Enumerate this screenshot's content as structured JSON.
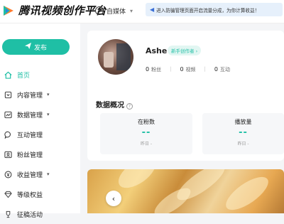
{
  "topbar": {
    "logo_text": "腾讯视频创作平台",
    "mode_label": "自媒体",
    "notice_text": "进入防骗管理页面开启流量分成，为你计算收益！"
  },
  "sidebar": {
    "post_label": "发布",
    "items": [
      {
        "label": "首页",
        "icon": "home-icon",
        "active": true,
        "arrow": false
      },
      {
        "label": "内容管理",
        "icon": "content-icon",
        "active": false,
        "arrow": true
      },
      {
        "label": "数据管理",
        "icon": "chart-icon",
        "active": false,
        "arrow": true
      },
      {
        "label": "互动管理",
        "icon": "chat-icon",
        "active": false,
        "arrow": false
      },
      {
        "label": "粉丝管理",
        "icon": "fans-icon",
        "active": false,
        "arrow": false
      },
      {
        "label": "收益管理",
        "icon": "coin-icon",
        "active": false,
        "arrow": true
      },
      {
        "label": "等级权益",
        "icon": "diamond-icon",
        "active": false,
        "arrow": false
      },
      {
        "label": "征稿活动",
        "icon": "trophy-icon",
        "active": false,
        "arrow": false
      }
    ]
  },
  "profile": {
    "name": "Ashe",
    "badge": "新手创作者 ›",
    "stats": [
      {
        "value": "0",
        "label": "粉丝"
      },
      {
        "value": "0",
        "label": "视频"
      },
      {
        "value": "0",
        "label": "互动"
      }
    ]
  },
  "overview": {
    "title": "数据概况",
    "metrics": [
      {
        "label": "在粉数",
        "value": "--",
        "delta": "昨日 -"
      },
      {
        "label": "播放量",
        "value": "--",
        "delta": "昨日 -"
      }
    ]
  },
  "banner": {
    "prev_label": "‹"
  },
  "colors": {
    "accent": "#1fbfa5",
    "notice_bg": "#e6f0fb"
  }
}
